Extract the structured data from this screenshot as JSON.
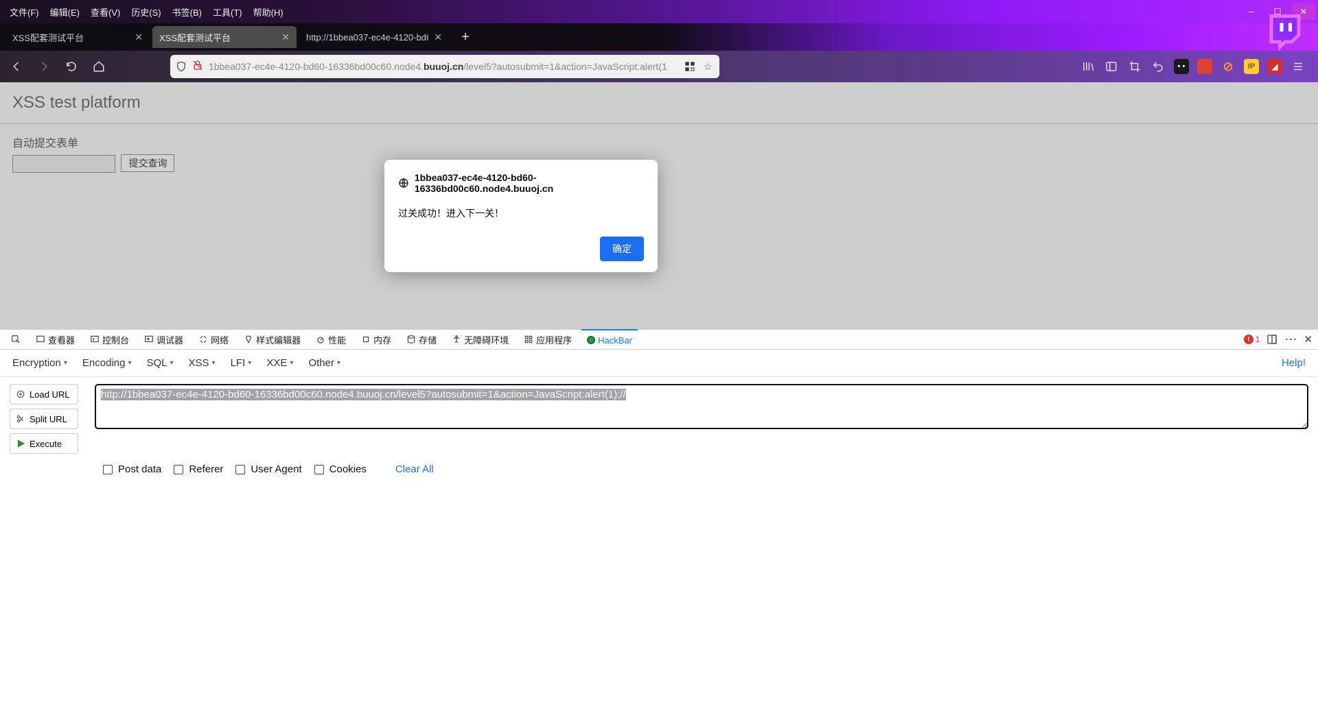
{
  "menubar": {
    "items": [
      "文件(F)",
      "编辑(E)",
      "查看(V)",
      "历史(S)",
      "书签(B)",
      "工具(T)",
      "帮助(H)"
    ]
  },
  "tabs": [
    {
      "label": "XSS配套测试平台",
      "active": false
    },
    {
      "label": "XSS配套测试平台",
      "active": true
    },
    {
      "label": "http://1bbea037-ec4e-4120-bd6",
      "active": false
    }
  ],
  "url": {
    "host_prefix": "1bbea037-ec4e-4120-bd60-16336bd00c60.node4.",
    "host_bold": "buuoj.cn",
    "path": "/level5?autosubmit=1&action=JavaScript:alert(1"
  },
  "page": {
    "heading": "XSS test platform",
    "form_label": "自动提交表单",
    "submit_label": "提交查询"
  },
  "dialog": {
    "domain": "1bbea037-ec4e-4120-bd60-16336bd00c60.node4.buuoj.cn",
    "message": "过关成功！进入下一关！",
    "ok": "确定"
  },
  "devtools": {
    "tabs": [
      "查看器",
      "控制台",
      "调试器",
      "网络",
      "样式编辑器",
      "性能",
      "内存",
      "存储",
      "无障碍环境",
      "应用程序",
      "HackBar"
    ],
    "error_count": "1"
  },
  "hackbar": {
    "menus": [
      "Encryption",
      "Encoding",
      "SQL",
      "XSS",
      "LFI",
      "XXE",
      "Other"
    ],
    "help": "Help!",
    "buttons": {
      "load": "Load URL",
      "split": "Split URL",
      "execute": "Execute"
    },
    "url_value": "http://1bbea037-ec4e-4120-bd60-16336bd00c60.node4.buuoj.cn/level5?autosubmit=1&action=JavaScript:alert(1);//",
    "options": [
      "Post data",
      "Referer",
      "User Agent",
      "Cookies"
    ],
    "clear_all": "Clear All"
  }
}
